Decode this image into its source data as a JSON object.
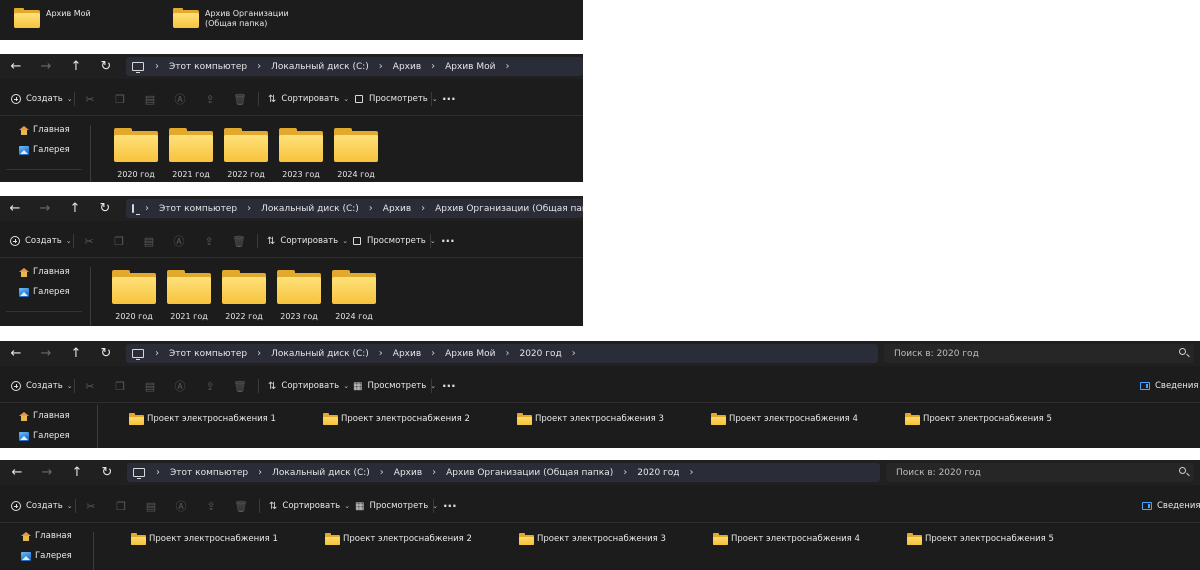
{
  "top_strip": {
    "items": [
      {
        "label": "Архив Мой"
      },
      {
        "label": "Архив Организации (Общая папка)"
      }
    ]
  },
  "common": {
    "toolbar": {
      "create": "Создать",
      "sort": "Сортировать",
      "view": "Просмотреть",
      "details": "Сведения"
    },
    "sidebar": {
      "home": "Главная",
      "gallery": "Галерея"
    }
  },
  "windows": [
    {
      "breadcrumb": [
        "Этот компьютер",
        "Локальный диск (C:)",
        "Архив",
        "Архив Мой"
      ],
      "folders": [
        "2020 год",
        "2021 год",
        "2022 год",
        "2023 год",
        "2024 год"
      ]
    },
    {
      "breadcrumb": [
        "Этот компьютер",
        "Локальный диск (C:)",
        "Архив",
        "Архив Организации (Общая папка)"
      ],
      "folders": [
        "2020 год",
        "2021 год",
        "2022 год",
        "2023 год",
        "2024 год"
      ]
    },
    {
      "breadcrumb": [
        "Этот компьютер",
        "Локальный диск (C:)",
        "Архив",
        "Архив Мой",
        "2020 год"
      ],
      "search_placeholder": "Поиск в: 2020 год",
      "folders": [
        "Проект электроснабжения 1",
        "Проект электроснабжения 2",
        "Проект электроснабжения 3",
        "Проект электроснабжения 4",
        "Проект электроснабжения 5"
      ]
    },
    {
      "breadcrumb": [
        "Этот компьютер",
        "Локальный диск (C:)",
        "Архив",
        "Архив Организации (Общая папка)",
        "2020 год"
      ],
      "search_placeholder": "Поиск в: 2020 год",
      "folders": [
        "Проект электроснабжения 1",
        "Проект электроснабжения 2",
        "Проект электроснабжения 3",
        "Проект электроснабжения 4",
        "Проект электроснабжения 5"
      ]
    }
  ]
}
